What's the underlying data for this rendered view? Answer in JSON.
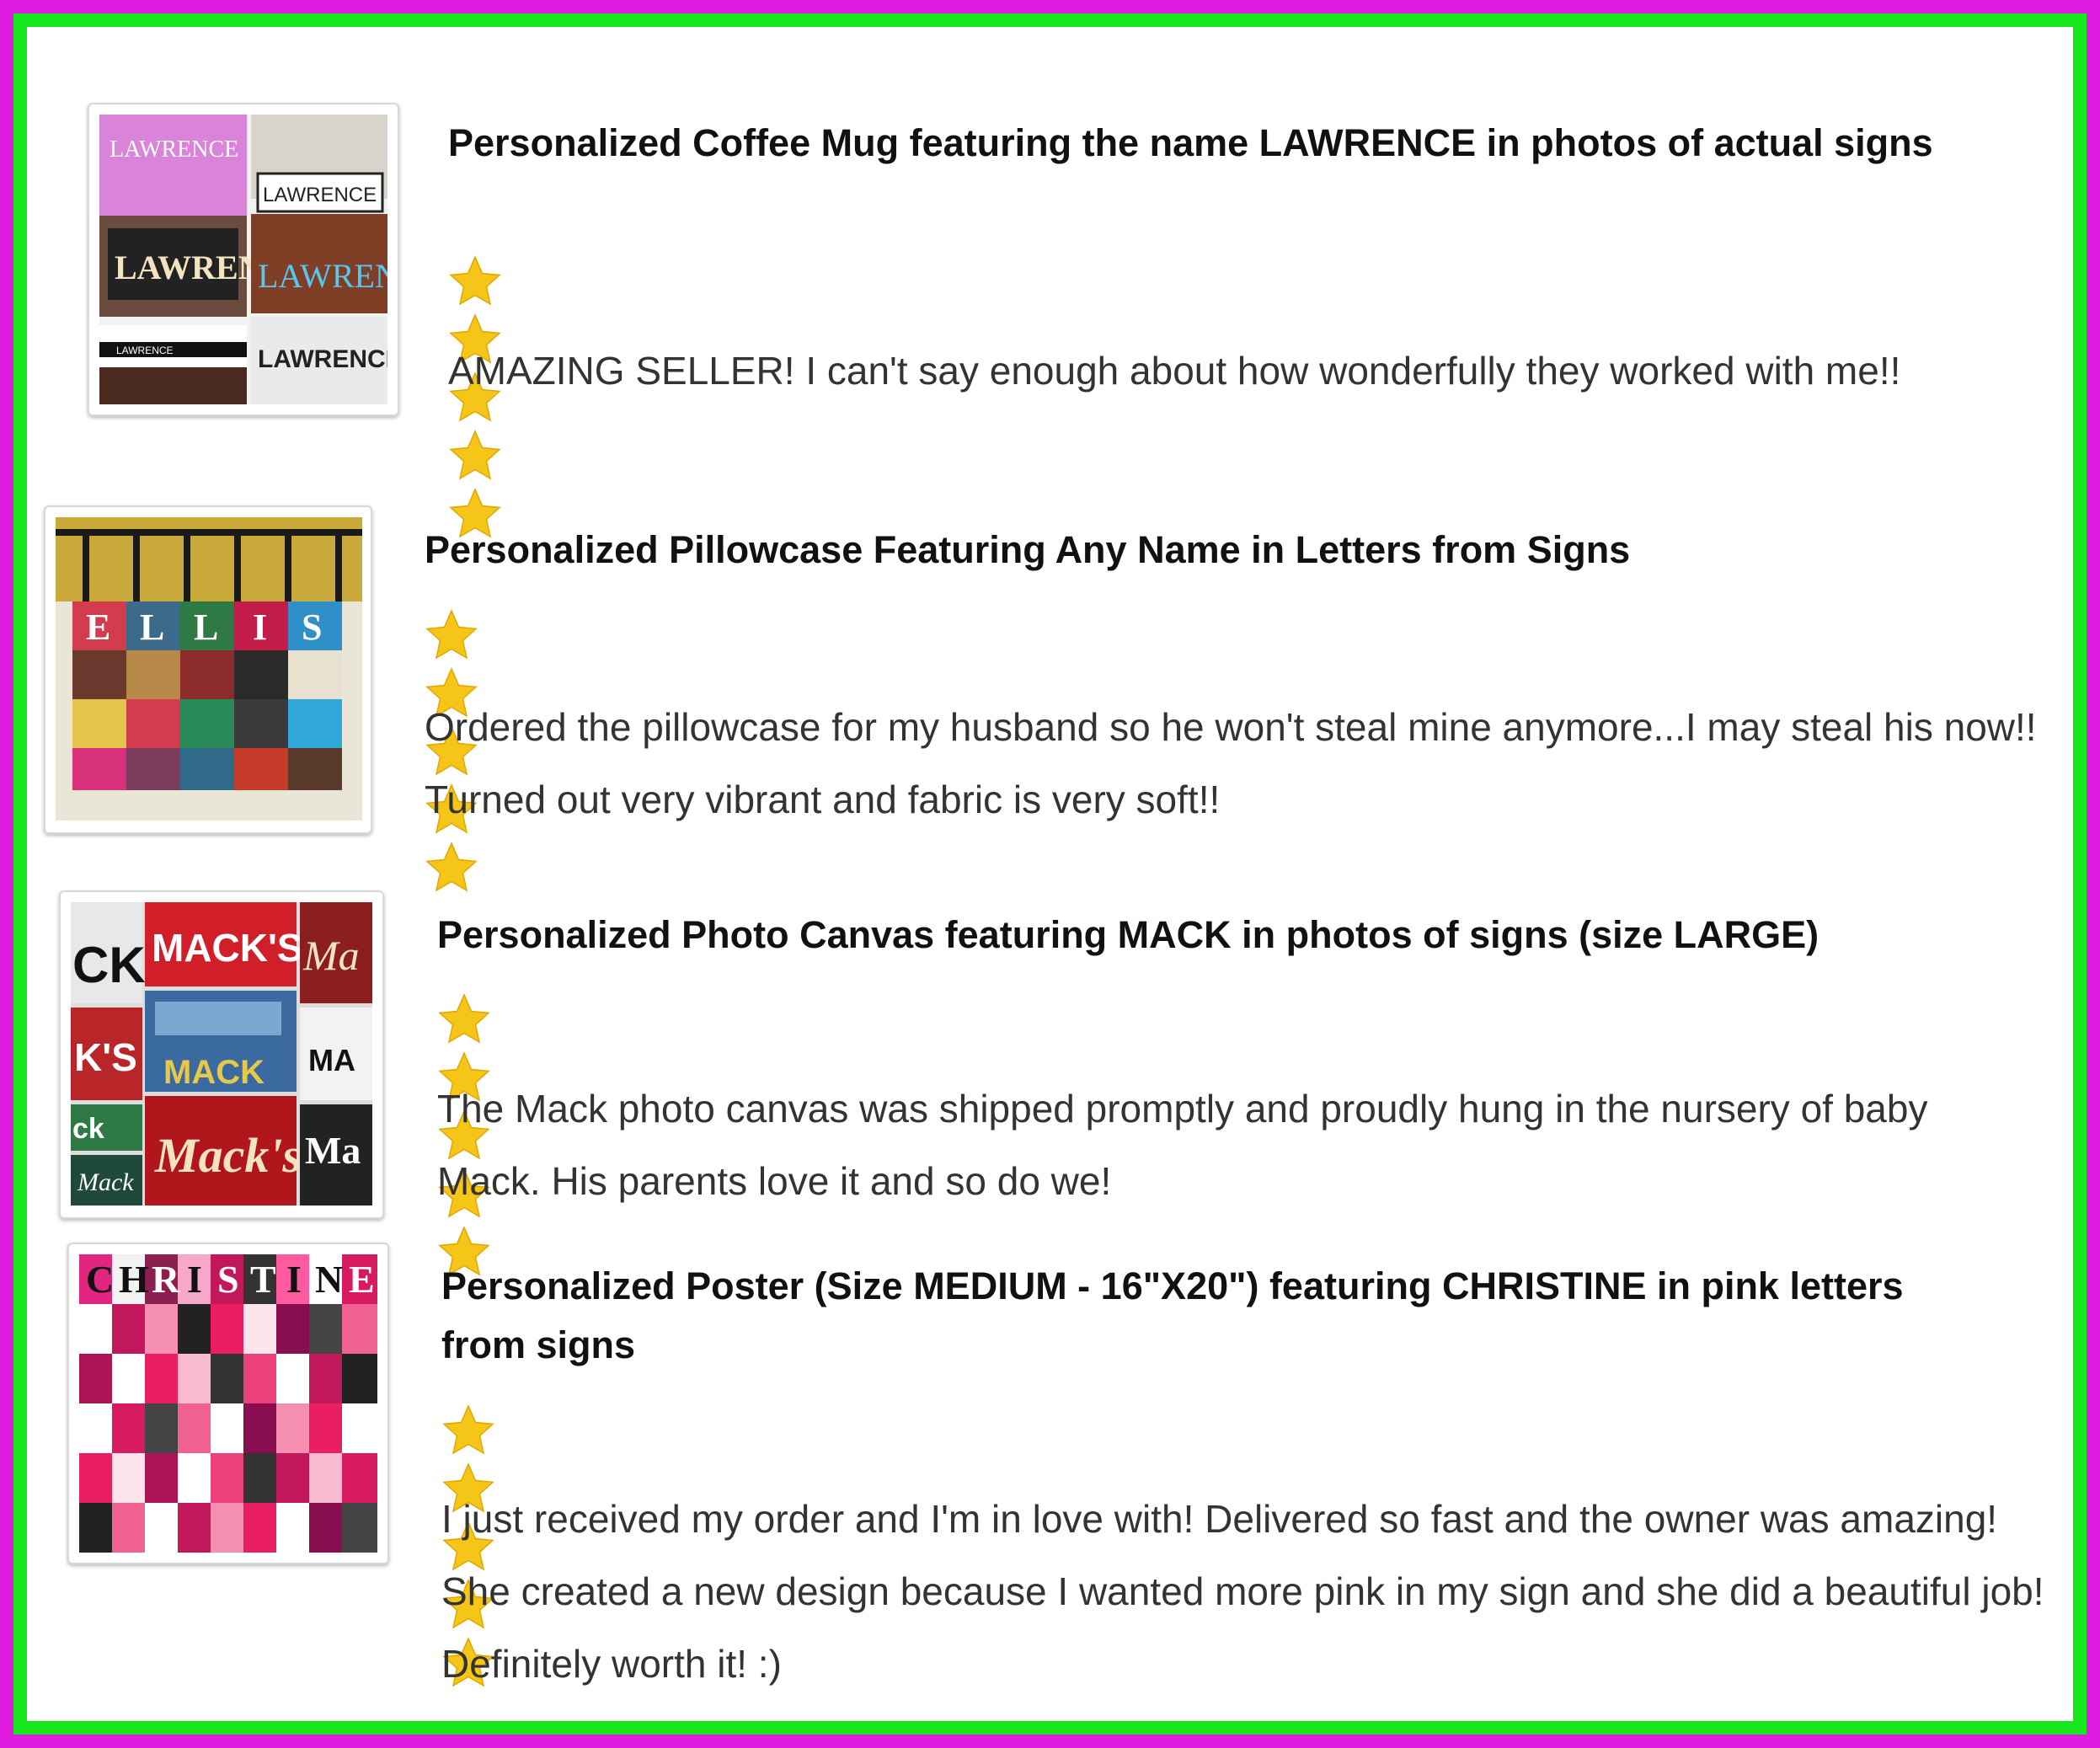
{
  "colors": {
    "outer_border": "#e01be0",
    "inner_border": "#17e81d",
    "star": "#f5c518"
  },
  "reviews": [
    {
      "title": "Personalized Coffee Mug featuring the name LAWRENCE in photos of actual signs",
      "rating": 5,
      "text": "AMAZING SELLER! I can't say enough about how wonderfully they worked with me!!",
      "image_labels": [
        "LAWRENCE",
        "LAWRENCE",
        "LAWRENCE",
        "LAWRENCE",
        "LAWRENCE",
        "LAWRENCE"
      ]
    },
    {
      "title": "Personalized Pillowcase Featuring Any Name in Letters from Signs",
      "rating": 5,
      "text": "Ordered the pillowcase for my husband so he won't steal mine anymore...I may steal his now!! Turned out very vibrant and fabric is very soft!!",
      "image_labels": [
        "E",
        "L",
        "L",
        "I",
        "S"
      ]
    },
    {
      "title": "Personalized Photo Canvas featuring MACK in photos of signs (size LARGE)",
      "rating": 5,
      "text": "The Mack photo canvas was shipped promptly and proudly hung in the nursery of baby Mack. His parents love it and so do we!",
      "image_labels": [
        "CK",
        "MACK'S",
        "Ma",
        "K'S",
        "MACK",
        "MA",
        "ck",
        "Mack's",
        "Ma",
        "Mack"
      ]
    },
    {
      "title": "Personalized Poster (Size MEDIUM - 16\"X20\") featuring CHRISTINE in pink letters from signs",
      "rating": 5,
      "text": "I just received my order and I'm in love with! Delivered so fast and the owner was amazing! She created a new design because I wanted more pink in my sign and she did a beautiful job! Definitely worth it! :)",
      "image_labels": [
        "C",
        "H",
        "R",
        "I",
        "S",
        "T",
        "I",
        "N",
        "E"
      ]
    }
  ]
}
